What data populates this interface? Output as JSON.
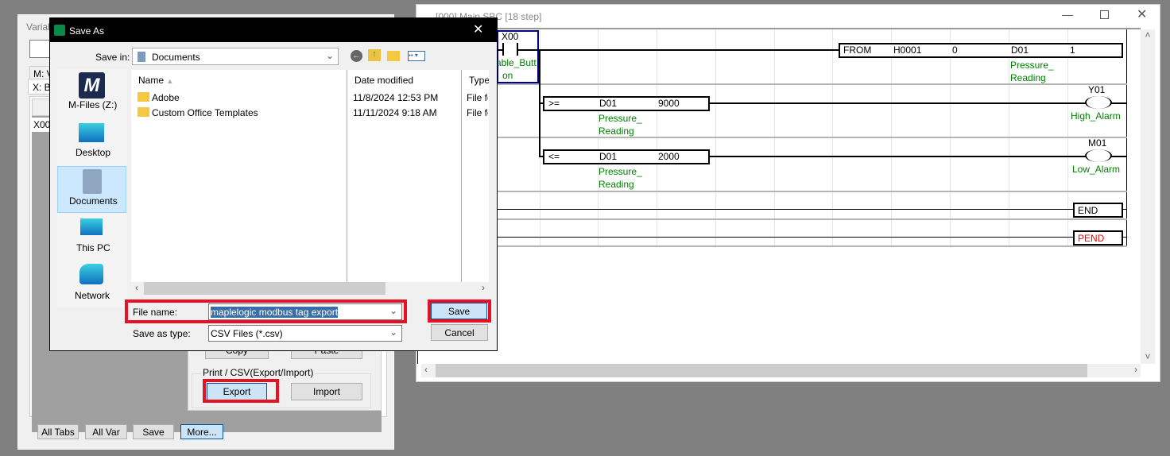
{
  "variable_window": {
    "title": "Variab",
    "tabs": [
      "M: V",
      "X: B"
    ],
    "row_first": "X00",
    "buttons": {
      "copy": "Copy",
      "paste": "Paste"
    },
    "group_label": "Print / CSV(Export/Import)",
    "export": "Export",
    "import": "Import",
    "bottom": [
      "All Tabs",
      "All Var",
      "Save",
      "More..."
    ]
  },
  "ladder_window": {
    "title": "[000] Main SBC [18 step]",
    "rung1": {
      "contact": "X00",
      "contact_label1": "able_Butt",
      "contact_label2": "on",
      "instr": "FROM",
      "op1": "H0001",
      "op2": "0",
      "op3": "D01",
      "op4": "1",
      "label1": "Pressure_",
      "label2": "Reading"
    },
    "rung2": {
      "cmp": ">=",
      "op1": "D01",
      "op2": "9000",
      "label1": "Pressure_",
      "label2": "Reading",
      "coil": "Y01",
      "coil_label": "High_Alarm"
    },
    "rung3": {
      "cmp": "<=",
      "op1": "D01",
      "op2": "2000",
      "label1": "Pressure_",
      "label2": "Reading",
      "coil": "M01",
      "coil_label": "Low_Alarm"
    },
    "end": "END",
    "pend": "PEND",
    "colors": {
      "pend": "#ff0000",
      "label": "#008000"
    }
  },
  "dialog": {
    "title": "Save As",
    "save_in_label": "Save in:",
    "save_in_value": "Documents",
    "places": [
      "M-Files (Z:)",
      "Desktop",
      "Documents",
      "This PC",
      "Network"
    ],
    "columns": [
      "Name",
      "Date modified",
      "Type"
    ],
    "files": [
      {
        "name": "Adobe",
        "date": "11/8/2024 12:53 PM",
        "type": "File fo"
      },
      {
        "name": "Custom Office Templates",
        "date": "11/11/2024 9:18 AM",
        "type": "File fo"
      }
    ],
    "file_name_label": "File name:",
    "file_name_value": "maplelogic modbus tag export",
    "save_type_label": "Save as type:",
    "save_type_value": "CSV Files (*.csv)",
    "save": "Save",
    "cancel": "Cancel"
  }
}
